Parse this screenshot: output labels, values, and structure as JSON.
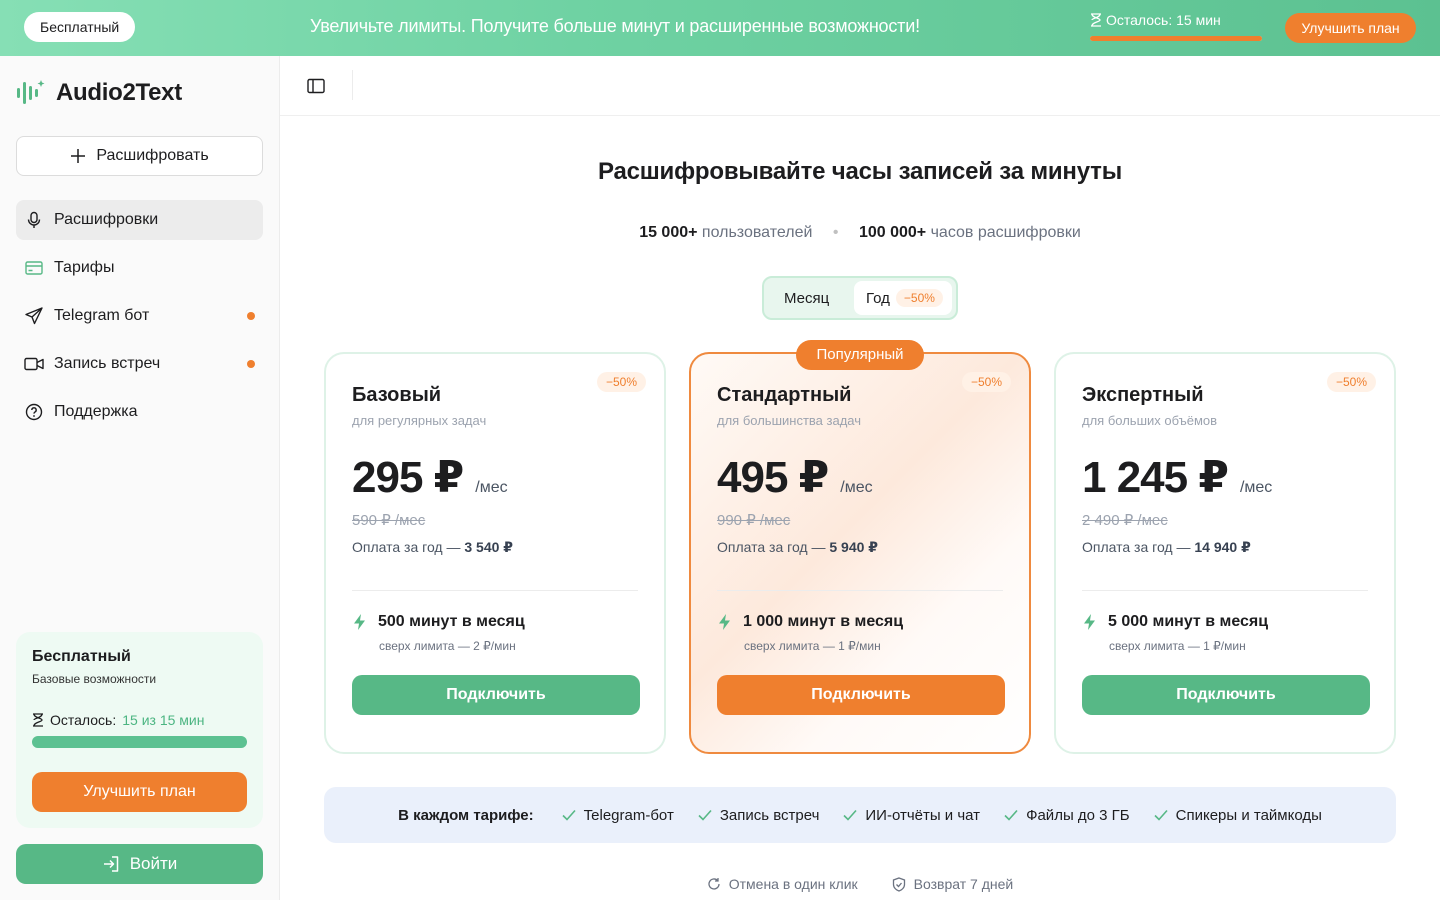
{
  "banner": {
    "badge": "Бесплатный",
    "message": "Увеличьте лимиты. Получите больше минут и расширенные возможности!",
    "remaining": "Осталось: 15 мин",
    "remaining_fraction": 1.0,
    "upgrade_label": "Улучшить план"
  },
  "sidebar": {
    "logo": "Audio2Text",
    "new_button": "Расшифровать",
    "items": [
      {
        "label": "Расшифровки",
        "icon": "microphone-icon",
        "active": true
      },
      {
        "label": "Тарифы",
        "icon": "card-icon"
      },
      {
        "label": "Telegram бот",
        "icon": "send-icon",
        "dot": true
      },
      {
        "label": "Запись встреч",
        "icon": "video-icon",
        "dot": true
      },
      {
        "label": "Поддержка",
        "icon": "help-icon"
      }
    ],
    "plan": {
      "name": "Бесплатный",
      "desc": "Базовые возможности",
      "remaining_label": "Осталось:",
      "remaining_value": "15 из 15 мин",
      "remaining_fraction": 1.0,
      "upgrade_label": "Улучшить план"
    },
    "login_label": "Войти"
  },
  "main": {
    "headline": "Расшифровывайте часы записей за минуты",
    "stats": [
      {
        "value": "15 000+",
        "label": "пользователей"
      },
      {
        "value": "100 000+",
        "label": "часов расшифровки"
      }
    ],
    "toggle": {
      "month": "Месяц",
      "year": "Год",
      "year_discount": "−50%",
      "selected": "year"
    },
    "plans": [
      {
        "title": "Базовый",
        "subtitle": "для регулярных задач",
        "discount": "−50%",
        "price": "295 ₽",
        "per": "/мес",
        "old_price": "590 ₽ /мес",
        "yearly_label": "Оплата за год —",
        "yearly_value": "3 540 ₽",
        "minutes": "500 минут в месяц",
        "overlimit": "сверх лимита — 2 ₽/мин",
        "button": "Подключить"
      },
      {
        "title": "Стандартный",
        "subtitle": "для большинства задач",
        "discount": "−50%",
        "price": "495 ₽",
        "per": "/мес",
        "old_price": "990 ₽ /мес",
        "yearly_label": "Оплата за год —",
        "yearly_value": "5 940 ₽",
        "minutes": "1 000 минут в месяц",
        "overlimit": "сверх лимита — 1 ₽/мин",
        "button": "Подключить",
        "tag": "Популярный"
      },
      {
        "title": "Экспертный",
        "subtitle": "для больших объёмов",
        "discount": "−50%",
        "price": "1 245 ₽",
        "per": "/мес",
        "old_price": "2 490 ₽ /мес",
        "yearly_label": "Оплата за год —",
        "yearly_value": "14 940 ₽",
        "minutes": "5 000 минут в месяц",
        "overlimit": "сверх лимита — 1 ₽/мин",
        "button": "Подключить"
      }
    ],
    "features": {
      "label": "В каждом тарифе:",
      "items": [
        "Telegram-бот",
        "Запись встреч",
        "ИИ-отчёты и чат",
        "Файлы до 3 ГБ",
        "Спикеры и таймкоды"
      ]
    },
    "guarantees": [
      "Отмена в один клик",
      "Возврат 7 дней"
    ]
  },
  "colors": {
    "green": "#57b886",
    "orange": "#ef7f2e",
    "banner_start": "#86dfb5",
    "banner_end": "#5cc191"
  }
}
